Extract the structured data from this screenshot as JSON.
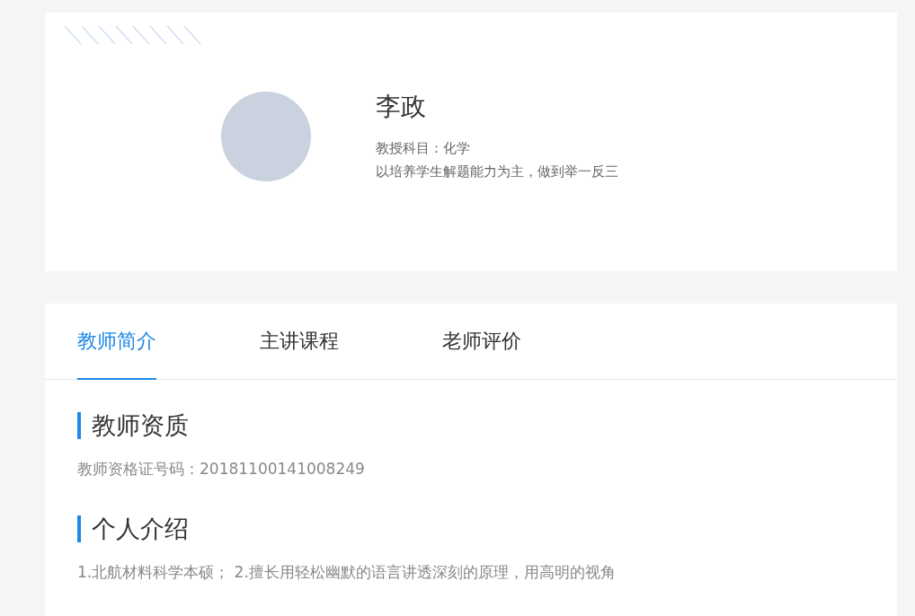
{
  "profile": {
    "name": "李政",
    "subject_label": "教授科目：",
    "subject": "化学",
    "motto": "以培养学生解题能力为主，做到举一反三"
  },
  "tabs": [
    {
      "label": "教师简介",
      "selected": true
    },
    {
      "label": "主讲课程",
      "selected": false
    },
    {
      "label": "老师评价",
      "selected": false
    }
  ],
  "sections": [
    {
      "title": "教师资质",
      "text": "教师资格证号码：20181100141008249"
    },
    {
      "title": "个人介绍",
      "text": "1.北航材料科学本硕；  2.擅长用轻松幽默的语言讲透深刻的原理，用高明的视角"
    }
  ]
}
